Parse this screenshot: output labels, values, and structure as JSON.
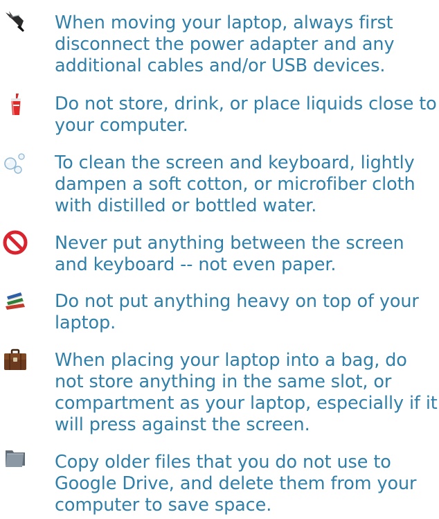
{
  "tips": [
    {
      "icon": "power-plug-icon",
      "text": "When moving your laptop, always first disconnect the power adapter and any additional cables and/or USB devices."
    },
    {
      "icon": "drink-cup-icon",
      "text": "Do not store, drink, or place liquids close to your computer."
    },
    {
      "icon": "bubbles-icon",
      "text": "To clean the screen and keyboard, lightly dampen a soft cotton, or microfiber cloth with distilled or bottled water."
    },
    {
      "icon": "prohibited-icon",
      "text": "Never put anything between the screen and keyboard -- not even paper."
    },
    {
      "icon": "books-icon",
      "text": "Do not put anything heavy on top of your laptop."
    },
    {
      "icon": "briefcase-icon",
      "text": "When placing your laptop into a bag, do not store anything in the same slot, or compartment as your laptop, especially if it will press against the screen."
    },
    {
      "icon": "folder-icon",
      "text": "Copy older files that you do not use to Google Drive, and delete them from your computer to save space."
    }
  ],
  "colors": {
    "text": "#2f7fa8",
    "prohibited": "#d9232e",
    "briefcase": "#6b3a1e",
    "folder": "#7e8a95"
  }
}
